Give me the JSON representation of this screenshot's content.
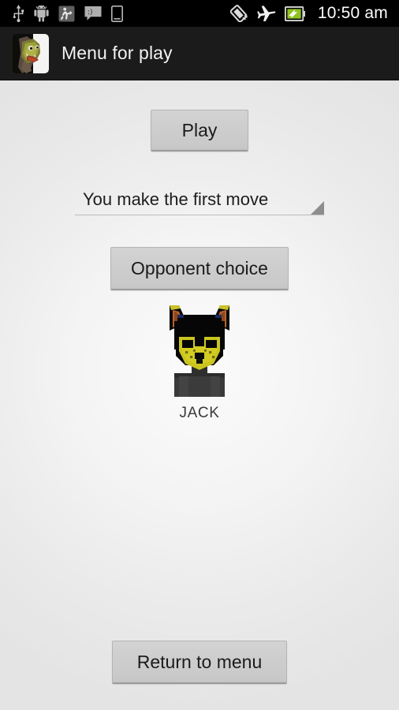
{
  "status_bar": {
    "time": "10:50 am",
    "left_icons": [
      {
        "name": "usb-icon",
        "glyph": "usb"
      },
      {
        "name": "android-robot-icon",
        "glyph": "android"
      },
      {
        "name": "debug-running-icon",
        "glyph": "adb"
      },
      {
        "name": "sms-message-icon",
        "glyph": "sms"
      },
      {
        "name": "sd-card-icon",
        "glyph": "sdcard"
      }
    ],
    "right_icons": [
      {
        "name": "auto-rotate-icon",
        "glyph": "rotate"
      },
      {
        "name": "airplane-mode-icon",
        "glyph": "airplane"
      },
      {
        "name": "battery-charging-icon",
        "glyph": "battery"
      }
    ],
    "background_color": "#000000",
    "text_color": "#ffffff"
  },
  "action_bar": {
    "title": "Menu for play",
    "icon_name": "app-logo-icon",
    "background_color": "#1b1b1b",
    "title_color": "#f2f2f2"
  },
  "main": {
    "play_label": "Play",
    "first_move_selected": "You make the first move",
    "first_move_options": [
      "You make the first move"
    ],
    "opponent_choice_label": "Opponent choice",
    "opponent_name": "JACK",
    "opponent_avatar_name": "opponent-avatar-jack",
    "return_label": "Return to menu",
    "button_face_color": "#cdcdcd",
    "button_text_color": "#1b1b1b",
    "background_color": "#ececec"
  }
}
